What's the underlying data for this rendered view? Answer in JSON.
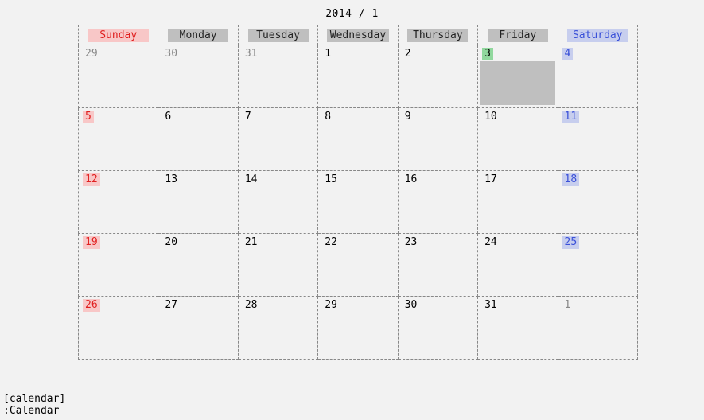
{
  "title": "2014 /  1",
  "headers": {
    "sun": "Sunday",
    "mon": "Monday",
    "tue": "Tuesday",
    "wed": "Wednesday",
    "thu": "Thursday",
    "fri": "Friday",
    "sat": "Saturday"
  },
  "weeks": [
    {
      "sun": "29",
      "mon": "30",
      "tue": "31",
      "wed": "1",
      "thu": "2",
      "fri": "3",
      "sat": "4"
    },
    {
      "sun": "5",
      "mon": "6",
      "tue": "7",
      "wed": "8",
      "thu": "9",
      "fri": "10",
      "sat": "11"
    },
    {
      "sun": "12",
      "mon": "13",
      "tue": "14",
      "wed": "15",
      "thu": "16",
      "fri": "17",
      "sat": "18"
    },
    {
      "sun": "19",
      "mon": "20",
      "tue": "21",
      "wed": "22",
      "thu": "23",
      "fri": "24",
      "sat": "25"
    },
    {
      "sun": "26",
      "mon": "27",
      "tue": "28",
      "wed": "29",
      "thu": "30",
      "fri": "31",
      "sat": "1"
    }
  ],
  "modeline": {
    "buffer": "[calendar]",
    "prompt": ":Calendar"
  }
}
